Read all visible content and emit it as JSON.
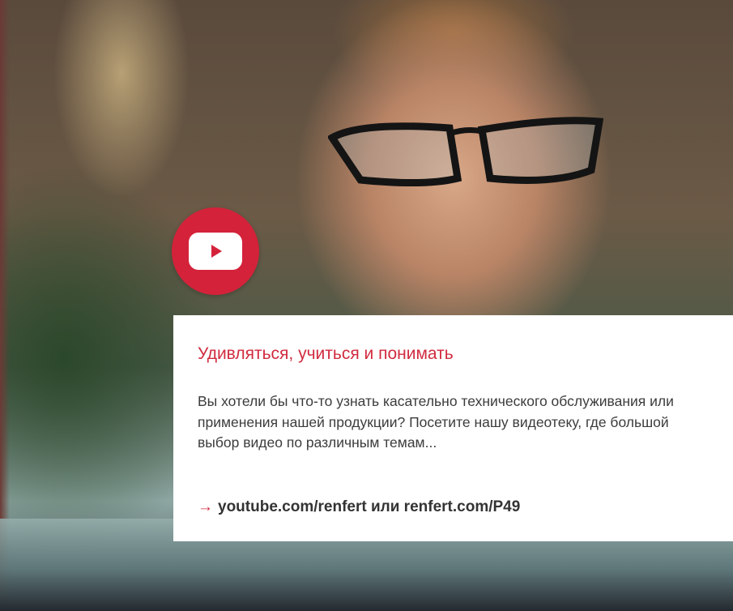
{
  "banner": {
    "photo_icon": "man-with-glasses-photo",
    "badge_icon": "youtube-play-icon",
    "accent_color": "#d12b3f",
    "title": "Удивляться, учиться и понимать",
    "description": "Вы хотели бы что-то узнать касательно технического обслуживания или применения нашей продукции? Посетите нашу видеотеку, где большой выбор видео по различным темам...",
    "link_arrow": "→",
    "link_text": "youtube.com/renfert или renfert.com/P49"
  }
}
